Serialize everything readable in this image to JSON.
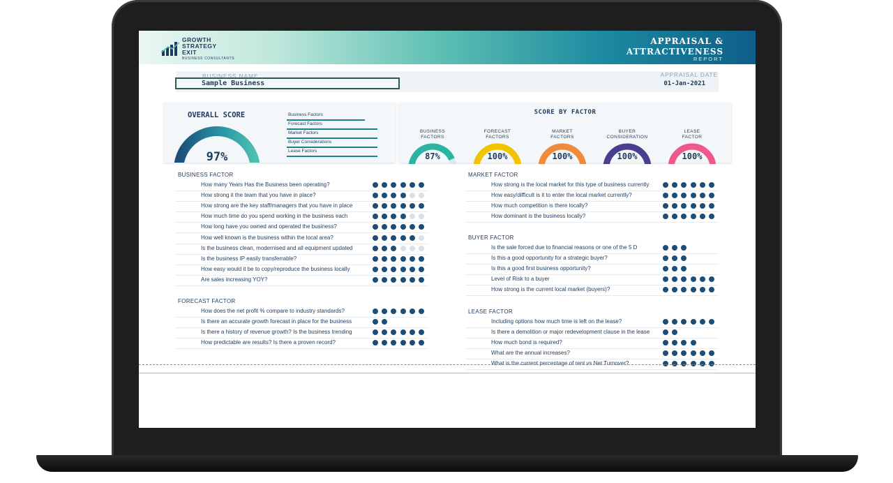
{
  "header": {
    "logo_lines": [
      "GROWTH",
      "STRATEGY",
      "EXIT"
    ],
    "logo_subtitle": "BUSINESS CONSULTANTS",
    "title_lines": [
      "APPRAISAL &",
      "ATTRACTIVENESS"
    ],
    "subtitle": "REPORT"
  },
  "business": {
    "name_label": "BUSINESS NAME",
    "name_value": "Sample Business",
    "date_label": "APPRAISAL DATE",
    "date_value": "01-Jan-2021"
  },
  "overall": {
    "title": "OVERALL SCORE",
    "score": "97%",
    "score_fraction": 0.97,
    "legend": [
      "Business Factors",
      "Forecast Factors",
      "Market Factors",
      "Buyer Considerations",
      "Lease Factors"
    ]
  },
  "score_by_factor": {
    "title": "SCORE BY FACTOR",
    "gauges": [
      {
        "label_lines": [
          "BUSINESS",
          "FACTORS"
        ],
        "value": "87%",
        "fraction": 0.87,
        "color": "#2bb3a3"
      },
      {
        "label_lines": [
          "FORECAST",
          "FACTORS"
        ],
        "value": "100%",
        "fraction": 1.0,
        "color": "#f2c400"
      },
      {
        "label_lines": [
          "MARKET",
          "FACTORS"
        ],
        "value": "100%",
        "fraction": 1.0,
        "color": "#f08a3c"
      },
      {
        "label_lines": [
          "BUYER",
          "CONSIDERATION"
        ],
        "value": "100%",
        "fraction": 1.0,
        "color": "#4a3e8e"
      },
      {
        "label_lines": [
          "LEASE",
          "FACTOR"
        ],
        "value": "100%",
        "fraction": 1.0,
        "color": "#ee5a8e"
      }
    ]
  },
  "colors": {
    "dot_on": "#1d4e78",
    "dot_off": "#d9e1e7",
    "track": "#dfe6ec"
  },
  "sections": {
    "business_factor": {
      "title": "BUSINESS FACTOR",
      "rows": [
        {
          "q": "How many Years Has the Business been operating?",
          "on": 6,
          "total": 6
        },
        {
          "q": "How strong it the team that you have in place?",
          "on": 4,
          "total": 6
        },
        {
          "q": "How strong are the key staff/managers that you have in place",
          "on": 6,
          "total": 6
        },
        {
          "q": "How much time do you spend working in the business each",
          "on": 4,
          "total": 6
        },
        {
          "q": "How long have you owned and operated the business?",
          "on": 6,
          "total": 6
        },
        {
          "q": "How well known is the business within the local area?",
          "on": 5,
          "total": 6
        },
        {
          "q": "Is the business  clean, modernised and all equipment updated",
          "on": 3,
          "total": 6
        },
        {
          "q": "Is the business IP easily transferrable?",
          "on": 6,
          "total": 6
        },
        {
          "q": "How easy would it be to copy/reproduce the business locally",
          "on": 6,
          "total": 6
        },
        {
          "q": "Are sales increasing YOY?",
          "on": 6,
          "total": 6
        }
      ]
    },
    "forecast_factor": {
      "title": "FORECAST FACTOR",
      "rows": [
        {
          "q": "How does the net profit % compare to industry standards?",
          "on": 6,
          "total": 6
        },
        {
          "q": "Is there an accurate growth forecast in place for the business",
          "on": 2,
          "total": 2
        },
        {
          "q": "Is there a history of revenue growth? Is the business trending",
          "on": 6,
          "total": 6
        },
        {
          "q": "How predictable are results? Is there a proven record?",
          "on": 6,
          "total": 6
        }
      ]
    },
    "market_factor": {
      "title": "MARKET FACTOR",
      "rows": [
        {
          "q": "How strong is the local market for this type of business currently",
          "on": 6,
          "total": 6
        },
        {
          "q": "How easy/difficult is it to enter the local market currently?",
          "on": 6,
          "total": 6
        },
        {
          "q": "How much competition is there locally?",
          "on": 6,
          "total": 6
        },
        {
          "q": "How dominant is the business locally?",
          "on": 6,
          "total": 6
        }
      ]
    },
    "buyer_factor": {
      "title": "BUYER FACTOR",
      "rows": [
        {
          "q": "Is the sale forced due to financial reasons or one of the 5 D",
          "on": 3,
          "total": 3
        },
        {
          "q": "Is this a  good opportunity for a strategic buyer?",
          "on": 3,
          "total": 3
        },
        {
          "q": "Is this a good first business opportunity?",
          "on": 3,
          "total": 3
        },
        {
          "q": "Level of Risk to a buyer",
          "on": 6,
          "total": 6
        },
        {
          "q": "How strong is the current local market (buyers)?",
          "on": 6,
          "total": 6
        }
      ]
    },
    "lease_factor": {
      "title": "LEASE FACTOR",
      "rows": [
        {
          "q": "Including options how much time is left on the lease?",
          "on": 6,
          "total": 6
        },
        {
          "q": "Is there a demolition or major redevelopment clause in the lease",
          "on": 2,
          "total": 2
        },
        {
          "q": "How much bond is required?",
          "on": 4,
          "total": 4
        },
        {
          "q": "What are the annual increases?",
          "on": 6,
          "total": 6
        },
        {
          "q": "What is the current percentage of rent vs Net Turnover?",
          "on": 6,
          "total": 6
        }
      ]
    }
  }
}
